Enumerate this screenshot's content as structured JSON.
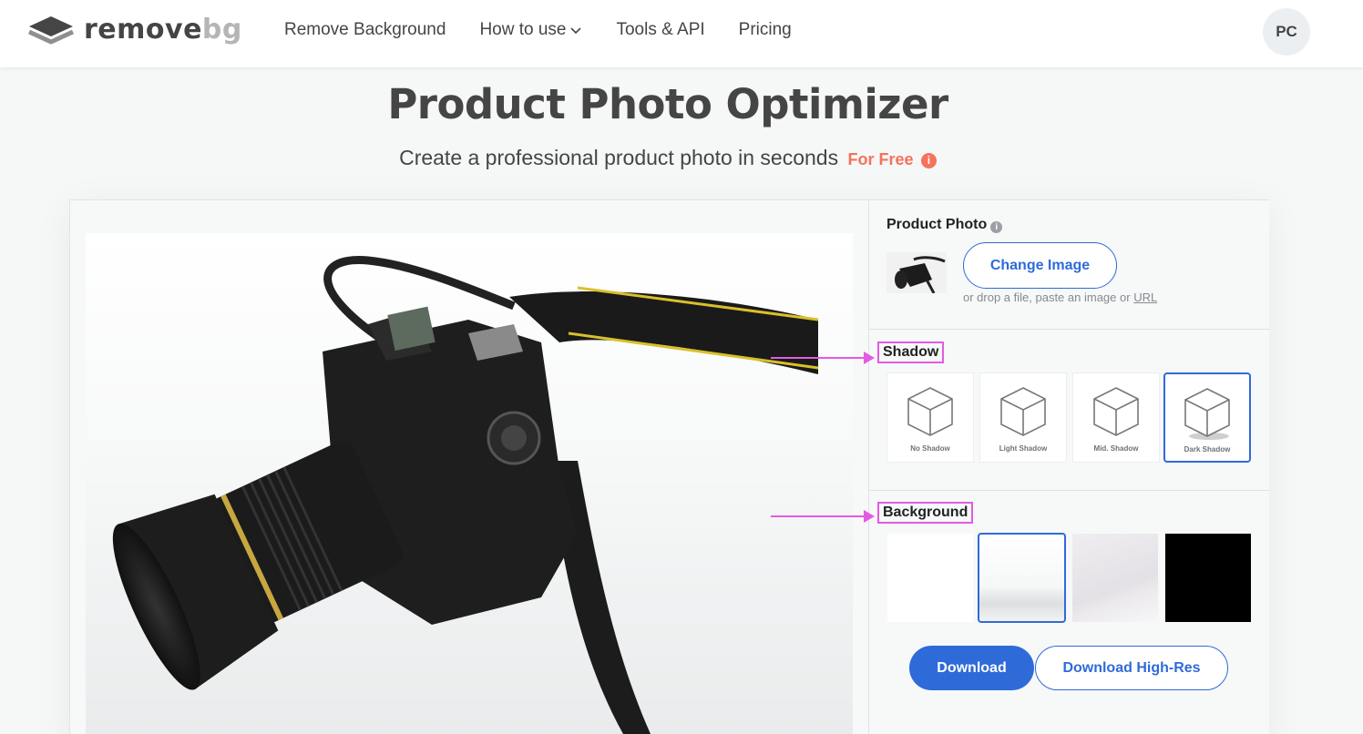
{
  "header": {
    "logo_text_main": "remove",
    "logo_text_sub": "bg",
    "nav": [
      {
        "label": "Remove Background"
      },
      {
        "label": "How to use"
      },
      {
        "label": "Tools & API"
      },
      {
        "label": "Pricing"
      }
    ],
    "avatar_initials": "PC"
  },
  "page": {
    "title": "Product Photo Optimizer",
    "subtitle": "Create a professional product photo in seconds",
    "free_badge": "For Free"
  },
  "panel": {
    "product_photo_label": "Product Photo",
    "change_image_label": "Change Image",
    "drop_hint": "or drop a file, paste an image or",
    "drop_hint_link": "URL",
    "shadow_label": "Shadow",
    "shadow_options": [
      {
        "label": "No Shadow",
        "selected": false
      },
      {
        "label": "Light Shadow",
        "selected": false
      },
      {
        "label": "Mid. Shadow",
        "selected": false
      },
      {
        "label": "Dark Shadow",
        "selected": true
      }
    ],
    "background_label": "Background",
    "background_options": [
      {
        "name": "white",
        "selected": false
      },
      {
        "name": "white-gradient",
        "selected": true
      },
      {
        "name": "light-gray-room",
        "selected": false
      },
      {
        "name": "black",
        "selected": false
      }
    ],
    "download_label": "Download",
    "download_hires_label": "Download High-Res"
  },
  "icons": {
    "logo": "layers-icon",
    "dropdown": "chevron-down-icon",
    "info": "info-icon",
    "shadow_option": "cube-icon",
    "annotation": "arrow-right-icon"
  },
  "colors": {
    "accent": "#2f6bd8",
    "free": "#f4735c",
    "annotation": "#e35be3"
  }
}
